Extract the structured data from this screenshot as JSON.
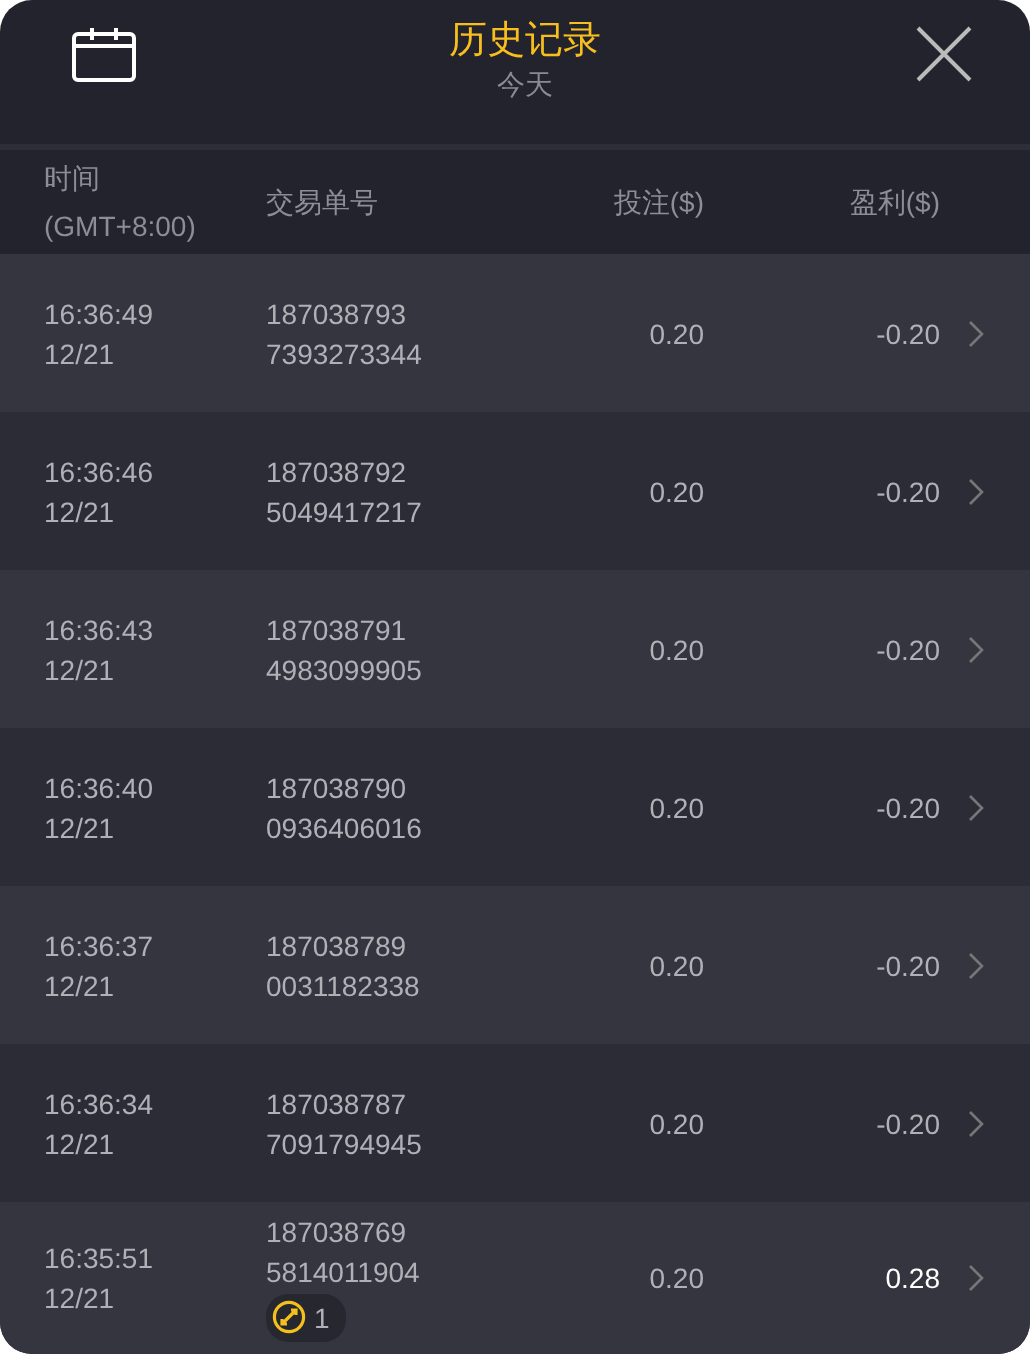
{
  "header": {
    "title": "历史记录",
    "subtitle": "今天"
  },
  "columns": [
    {
      "lines": [
        "时间",
        "(GMT+8:00)"
      ]
    },
    {
      "lines": [
        "交易单号"
      ]
    },
    {
      "lines": [
        "投注($)"
      ]
    },
    {
      "lines": [
        "盈利($)"
      ]
    }
  ],
  "rows": [
    {
      "time": "16:36:49",
      "date": "12/21",
      "order": [
        "187038793",
        "7393273344"
      ],
      "stake": "0.20",
      "profit": "-0.20",
      "kind": "loss"
    },
    {
      "time": "16:36:46",
      "date": "12/21",
      "order": [
        "187038792",
        "5049417217"
      ],
      "stake": "0.20",
      "profit": "-0.20",
      "kind": "loss"
    },
    {
      "time": "16:36:43",
      "date": "12/21",
      "order": [
        "187038791",
        "4983099905"
      ],
      "stake": "0.20",
      "profit": "-0.20",
      "kind": "loss"
    },
    {
      "time": "16:36:40",
      "date": "12/21",
      "order": [
        "187038790",
        "0936406016"
      ],
      "stake": "0.20",
      "profit": "-0.20",
      "kind": "loss"
    },
    {
      "time": "16:36:37",
      "date": "12/21",
      "order": [
        "187038789",
        "0031182338"
      ],
      "stake": "0.20",
      "profit": "-0.20",
      "kind": "loss"
    },
    {
      "time": "16:36:34",
      "date": "12/21",
      "order": [
        "187038787",
        "7091794945"
      ],
      "stake": "0.20",
      "profit": "-0.20",
      "kind": "loss"
    },
    {
      "time": "16:35:51",
      "date": "12/21",
      "order": [
        "187038769",
        "5814011904"
      ],
      "stake": "0.20",
      "profit": "0.28",
      "kind": "win",
      "badge": "1"
    }
  ]
}
